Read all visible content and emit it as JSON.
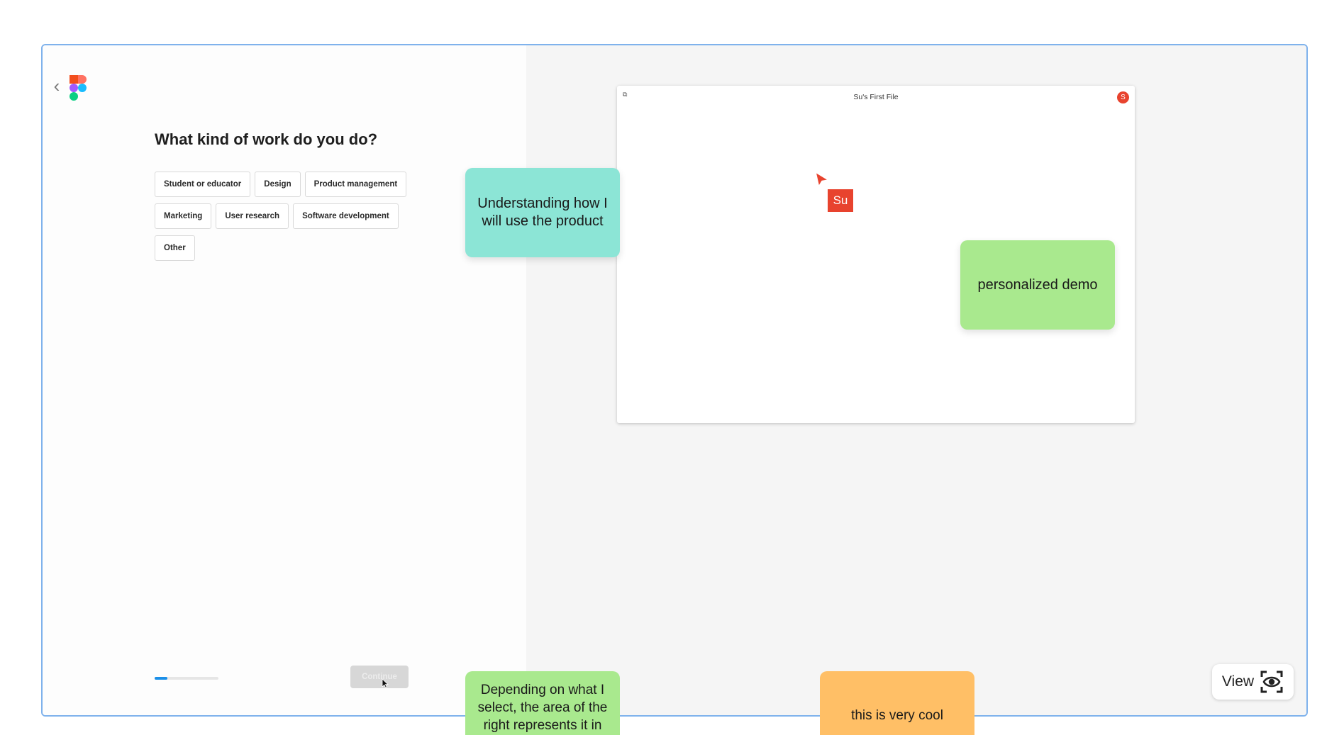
{
  "onboarding": {
    "question": "What kind of work do you do?",
    "options": [
      "Student or educator",
      "Design",
      "Product management",
      "Marketing",
      "User research",
      "Software development",
      "Other"
    ],
    "continue_label": "Continue",
    "progress": 0.2
  },
  "preview": {
    "file_title": "Su's First File",
    "avatar_initial": "S",
    "collaborator_label": "Su"
  },
  "stickies": {
    "teal": "Understanding how I will use the product",
    "green": "personalized demo",
    "green_bottom": "Depending on what I select, the area of the right represents it in",
    "orange_bottom": "this is very cool"
  },
  "controls": {
    "view_label": "View"
  },
  "colors": {
    "accent_blue": "#1b8fe8",
    "frame_border": "#7fb2ec",
    "collaborator_red": "#e8432e",
    "sticky_teal": "#8ce5d6",
    "sticky_green": "#a9e98e",
    "sticky_orange": "#ffbf66"
  }
}
